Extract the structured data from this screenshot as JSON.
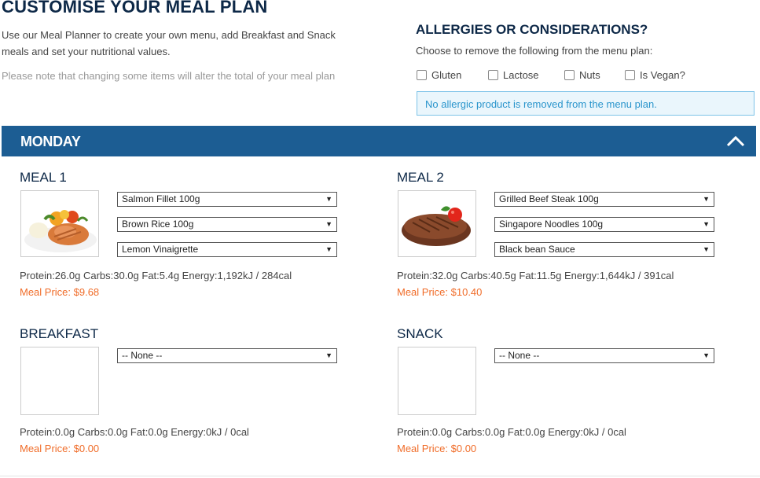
{
  "page": {
    "title": "CUSTOMISE YOUR MEAL PLAN",
    "intro": "Use our Meal Planner to create your own menu, add Breakfast and Snack meals and set your nutritional values.",
    "note": "Please note that changing some items will alter the total of your meal plan"
  },
  "allergies": {
    "title": "ALLERGIES OR CONSIDERATIONS?",
    "subtitle": "Choose to remove the following from the menu plan:",
    "options": [
      "Gluten",
      "Lactose",
      "Nuts",
      "Is Vegan?"
    ],
    "notice": "No allergic product is removed from the menu plan."
  },
  "day": {
    "label": "MONDAY"
  },
  "meals": [
    {
      "title": "MEAL 1",
      "selects": [
        "Salmon Fillet 100g",
        "Brown Rice 100g",
        "Lemon Vinaigrette"
      ],
      "nutrition": "Protein:26.0g Carbs:30.0g Fat:5.4g Energy:1,192kJ / 284cal",
      "price": "Meal Price: $9.68"
    },
    {
      "title": "MEAL 2",
      "selects": [
        "Grilled Beef Steak 100g",
        "Singapore Noodles 100g",
        "Black bean Sauce"
      ],
      "nutrition": "Protein:32.0g Carbs:40.5g Fat:11.5g Energy:1,644kJ / 391cal",
      "price": "Meal Price: $10.40"
    },
    {
      "title": "BREAKFAST",
      "selects": [
        "-- None --"
      ],
      "nutrition": "Protein:0.0g Carbs:0.0g Fat:0.0g Energy:0kJ / 0cal",
      "price": "Meal Price: $0.00"
    },
    {
      "title": "SNACK",
      "selects": [
        "-- None --"
      ],
      "nutrition": "Protein:0.0g Carbs:0.0g Fat:0.0g Energy:0kJ / 0cal",
      "price": "Meal Price: $0.00"
    }
  ],
  "icons": {
    "collapse": "chevron-up-icon",
    "dropdown": "dropdown-arrow-icon"
  },
  "colors": {
    "primary": "#1c5d93",
    "heading": "#0d2847",
    "price": "#f06d2a",
    "notice_bg": "#eaf6fc",
    "notice_text": "#2a95cc"
  }
}
